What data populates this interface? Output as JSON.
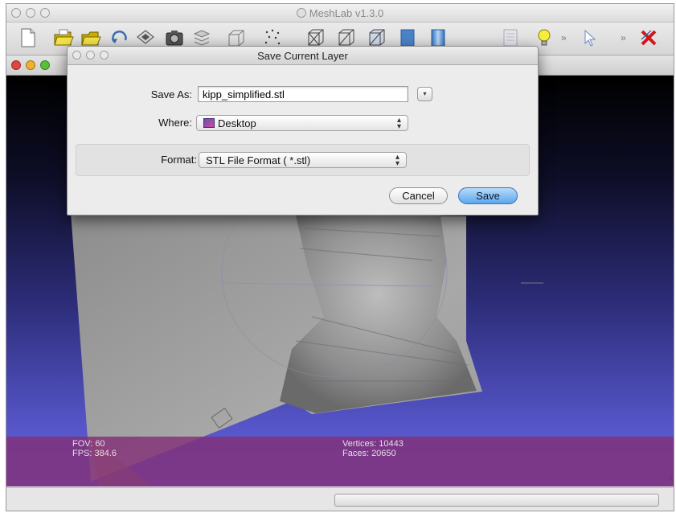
{
  "window": {
    "title": "MeshLab v1.3.0"
  },
  "toolbar": {
    "icons": [
      "new-document-icon",
      "open-folder-icon",
      "open-project-icon",
      "reload-icon",
      "save-icon",
      "snapshot-icon",
      "layers-icon",
      "bounding-box-icon",
      "points-icon",
      "wireframe-icon",
      "hidden-lines-icon",
      "flat-lines-icon",
      "flat-shading-icon",
      "smooth-shading-icon",
      "texture-icon",
      "light-bulb-icon",
      "select-icon",
      "delete-icon"
    ],
    "overflow_label": "»"
  },
  "dialog": {
    "title": "Save Current Layer",
    "save_as_label": "Save As:",
    "filename": "kipp_simplified.stl",
    "where_label": "Where:",
    "where_value": "Desktop",
    "format_label": "Format:",
    "format_value": "STL File Format ( *.stl)",
    "cancel_label": "Cancel",
    "save_label": "Save",
    "expand_glyph": "▾"
  },
  "viewport": {
    "fov_label": "FOV: 60",
    "fps_label": "FPS:  384.6",
    "vertices_label": "Vertices: 10443",
    "faces_label": "Faces: 20650"
  },
  "colors": {
    "info_bar": "#82307a",
    "viewport_bottom": "#6464d6",
    "save_button": "#5ba7ec"
  }
}
